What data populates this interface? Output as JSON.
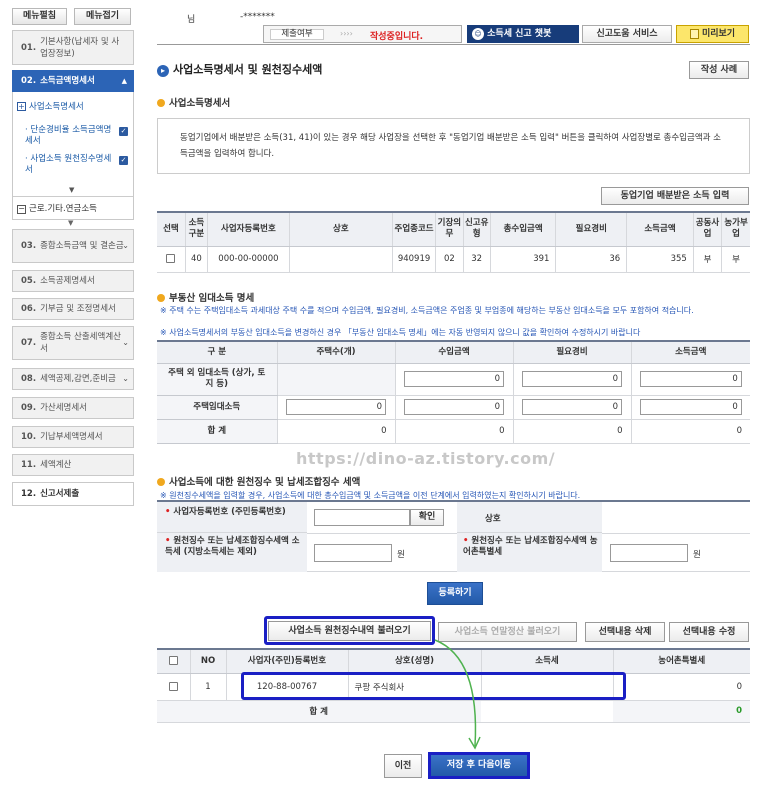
{
  "sidebar": {
    "top_buttons": [
      "메뉴펼침",
      "메뉴접기"
    ],
    "items": [
      {
        "num": "01.",
        "label": "기본사항(납세자 및 사업장정보)"
      },
      {
        "num": "02.",
        "label": "소득금액명세서"
      },
      {
        "num": "03.",
        "label": "종합소득금액 및 결손금"
      },
      {
        "num": "05.",
        "label": "소득공제명세서"
      },
      {
        "num": "06.",
        "label": "기부금 및 조정명세서"
      },
      {
        "num": "07.",
        "label": "종합소득 산출세액계산서"
      },
      {
        "num": "08.",
        "label": "세액공제,감면,준비금"
      },
      {
        "num": "09.",
        "label": "가산세명세서"
      },
      {
        "num": "10.",
        "label": "기납부세액명세서"
      },
      {
        "num": "11.",
        "label": "세액계산"
      },
      {
        "num": "12.",
        "label": "신고서제출"
      }
    ],
    "sub_items": {
      "s1": "사업소득명세서",
      "s2": "단순경비율 소득금액명세서",
      "s3": "사업소득 원천징수명세서",
      "s4": "근로.기타.연금소득"
    }
  },
  "header": {
    "name_label": "님",
    "masked": "-*******",
    "submit_label": "제출여부",
    "arrows": "››››",
    "status": "작성중입니다.",
    "chatbot": "소득세 신고 챗봇",
    "help": "신고도움 서비스",
    "preview": "미리보기"
  },
  "page": {
    "title": "사업소득명세서 및 원천징수세액",
    "example_btn": "작성 사례"
  },
  "business": {
    "heading": "사업소득명세서",
    "notice": "동업기업에서 배분받은 소득(31, 41)이 있는 경우 해당 사업장을 선택한 후 \"동업기업 배분받은 소득 입력\" 버튼을 클릭하여 사업장별로 총수입금액과 소득금액을 입력하여 합니다.",
    "partner_btn": "동업기업 배분받은 소득 입력",
    "columns": [
      "선택",
      "소득구분",
      "사업자등록번호",
      "상호",
      "주업종코드",
      "기장의무",
      "신고유형",
      "총수입금액",
      "필요경비",
      "소득금액",
      "공동사업",
      "농가부업"
    ],
    "row": {
      "income_type": "40",
      "reg_no": "000-00-00000",
      "name": "",
      "code": "940919",
      "duty": "02",
      "type": "32",
      "revenue": "391",
      "expense": "36",
      "income": "355",
      "joint": "부",
      "farm": "부"
    }
  },
  "rent": {
    "heading": "부동산 임대소득 명세",
    "note1": "※ 주택 수는 주택임대소득 과세대상 주택 수를 적으며 수입금액, 필요경비, 소득금액은 주업종 및 부업종에 해당하는 부동산 임대소득을 모두 포함하여 적습니다.",
    "note2": "※ 사업소득명세서의 부동산 임대소득을 변경하신 경우 「부동산 임대소득 명세」에는 자동 반영되지 않으니 값을 확인하여 수정하시기 바랍니다",
    "columns": [
      "구 분",
      "주택수(개)",
      "수입금액",
      "필요경비",
      "소득금액"
    ],
    "rows": [
      {
        "label": "주택 외 임대소득 (상가, 토지 등)",
        "count": "",
        "revenue": "0",
        "expense": "0",
        "income": "0"
      },
      {
        "label": "주택임대소득",
        "count": "0",
        "revenue": "0",
        "expense": "0",
        "income": "0"
      },
      {
        "label": "합 계",
        "count": "0",
        "revenue": "0",
        "expense": "0",
        "income": "0"
      }
    ]
  },
  "withholding": {
    "heading": "사업소득에 대한 원천징수 및 납세조합징수 세액",
    "note": "※ 원천징수세액을 입력할 경우, 사업소득에 대한 총수입금액 및 소득금액을 이전 단계에서 입력하였는지 확인하시기 바랍니다.",
    "f1": "사업자등록번호 (주민등록번호)",
    "confirm": "확인",
    "f2": "상호",
    "f3": "원천징수 또는 납세조합징수세액 소득세 (지방소득세는 제외)",
    "f4": "원천징수 또는 납세조합징수세액 농어촌특별세",
    "won": "원",
    "register": "등록하기",
    "btns": [
      "사업소득 원천징수내역 불러오기",
      "사업소득 연말정산 불러오기",
      "선택내용 삭제",
      "선택내용 수정"
    ],
    "columns": [
      "",
      "NO",
      "사업자(주민)등록번호",
      "상호(성명)",
      "소득세",
      "농어촌특별세"
    ],
    "row": {
      "no": "1",
      "reg": "120-88-00767",
      "name": "쿠팡 주식회사",
      "tax": "",
      "rural": "0"
    },
    "total_label": "합 계",
    "total_rural": "0"
  },
  "footer": {
    "prev": "이전",
    "next": "저장 후 다음이동"
  },
  "watermark": "https://dino-az.tistory.com/"
}
